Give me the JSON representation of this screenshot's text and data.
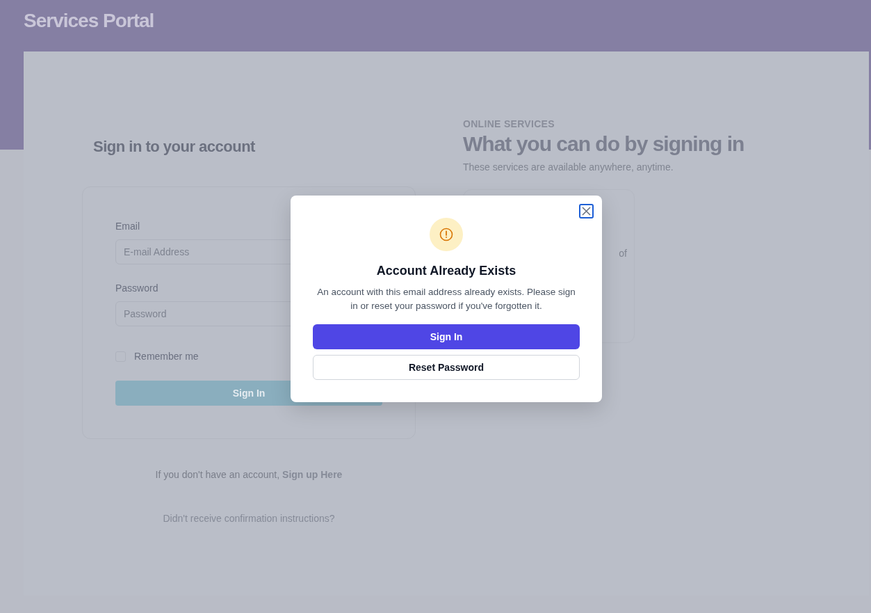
{
  "header": {
    "title": "Services Portal"
  },
  "sign_in": {
    "heading": "Sign in to your account",
    "fields": [
      {
        "label": "Email",
        "placeholder": "E-mail Address"
      },
      {
        "label": "Password",
        "placeholder": "Password"
      }
    ],
    "remember": {
      "label": "Remember me",
      "checked": false
    },
    "button": "Sign In",
    "signup_prompt": {
      "text": "If you don't have an account,",
      "link": "Sign up Here"
    },
    "confirmation_link": "Didn't receive confirmation instructions?"
  },
  "services": {
    "eyebrow": "ONLINE SERVICES",
    "title": "What you can do by signing in",
    "subtitle": "These services are available anywhere, anytime.",
    "card_fragment": "of"
  },
  "modal": {
    "title": "Account Already Exists",
    "message": "An account with this email address already exists. Please sign in or reset your password if you've forgotten it.",
    "buttons": [
      {
        "label": "Sign In",
        "kind": "primary"
      },
      {
        "label": "Reset Password",
        "kind": "secondary"
      }
    ]
  }
}
